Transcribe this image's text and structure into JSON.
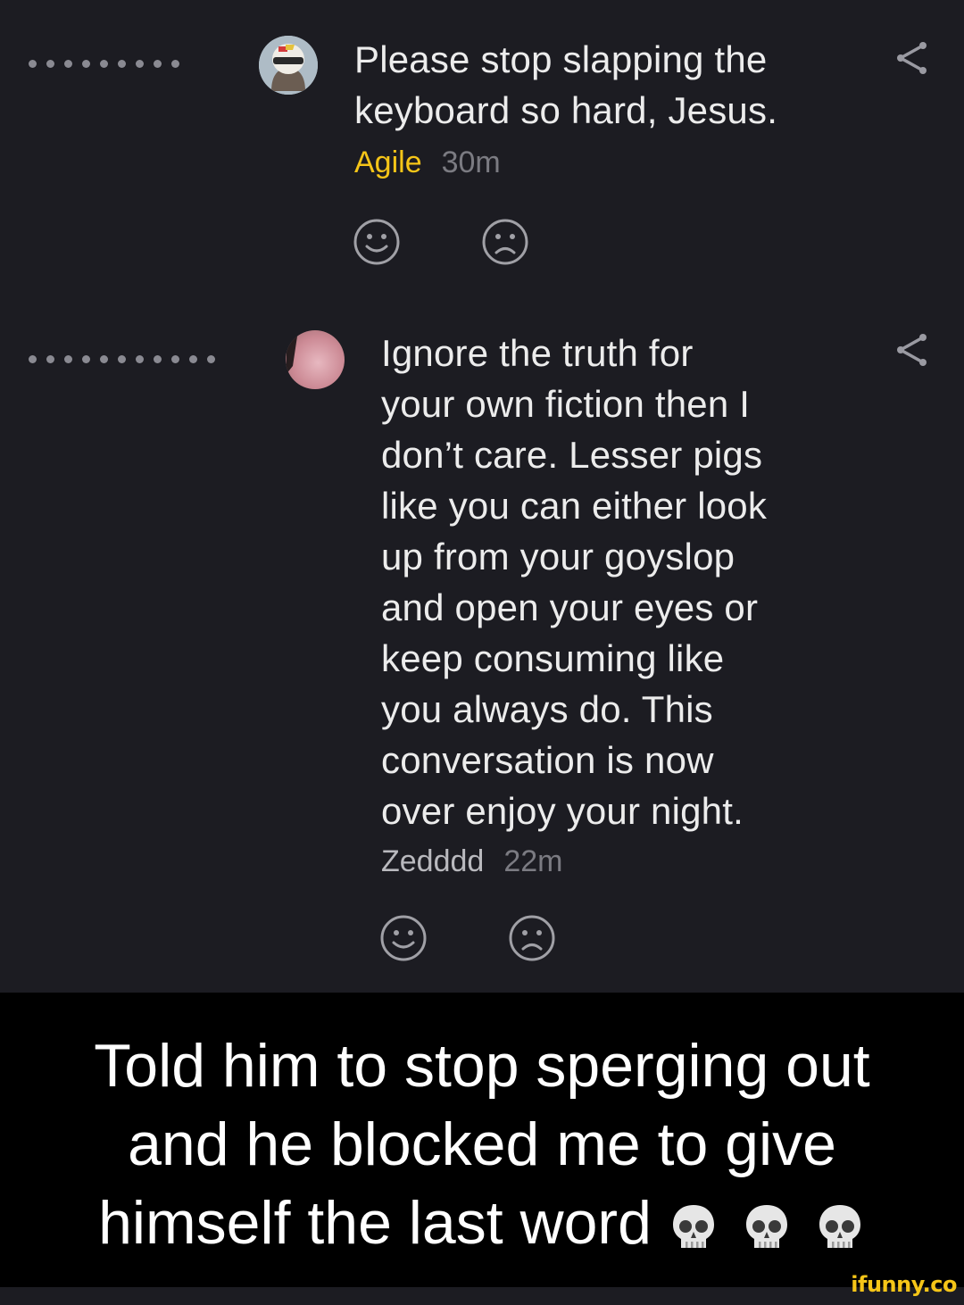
{
  "comments": [
    {
      "text": "Please stop slapping the\nkeyboard so hard, Jesus.",
      "username": "Agile",
      "username_color": "#f5c518",
      "time": "30m",
      "icons": [
        "thread-dots-icon",
        "avatar",
        "share-icon",
        "smile-icon",
        "frown-icon"
      ]
    },
    {
      "text": "Ignore the truth for\nyour own fiction then I\ndon’t care. Lesser pigs\nlike you can either look\nup from your goyslop\nand open your eyes or\nkeep consuming like\nyou always do. This\nconversation is now\nover enjoy your night.",
      "username": "Zedddd",
      "username_color": "#b9b9be",
      "time": "22m",
      "icons": [
        "thread-dots-icon",
        "avatar",
        "share-icon",
        "smile-icon",
        "frown-icon"
      ]
    }
  ],
  "caption": {
    "text": "Told him to stop sperging out\nand he blocked me to give\nhimself the last word",
    "emoji": [
      "skull-icon",
      "skull-icon",
      "skull-icon"
    ]
  },
  "watermark": "ifunny.co",
  "colors": {
    "background": "#1c1c22",
    "caption_background": "#000000",
    "accent": "#f5c518"
  }
}
